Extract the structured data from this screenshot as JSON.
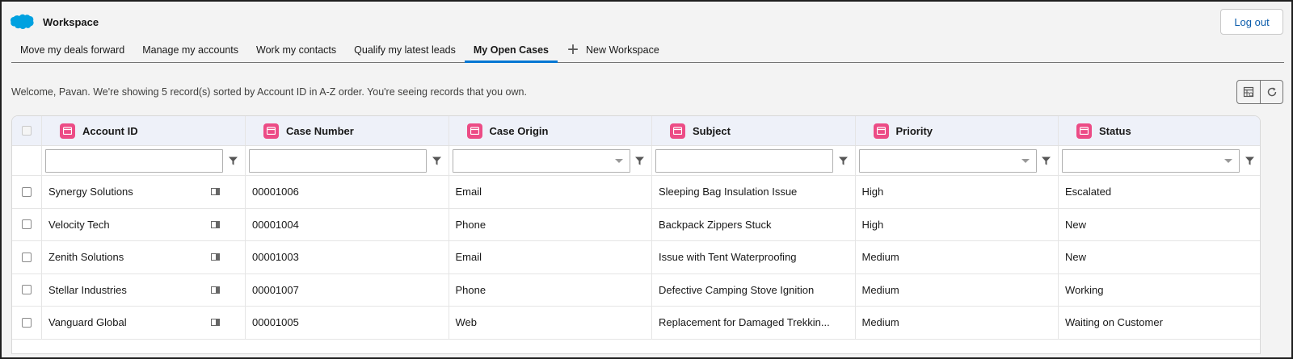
{
  "app": {
    "title": "Workspace",
    "logout_label": "Log out"
  },
  "tabs": [
    {
      "label": "Move my deals forward",
      "active": false
    },
    {
      "label": "Manage my accounts",
      "active": false
    },
    {
      "label": "Work my contacts",
      "active": false
    },
    {
      "label": "Qualify my latest leads",
      "active": false
    },
    {
      "label": "My Open Cases",
      "active": true
    }
  ],
  "new_tab_label": "New Workspace",
  "welcome_text": "Welcome, Pavan. We're showing 5 record(s) sorted by Account ID in A-Z order. You're seeing records that you own.",
  "columns": [
    {
      "label": "Account ID",
      "filter": "text"
    },
    {
      "label": "Case Number",
      "filter": "text"
    },
    {
      "label": "Case Origin",
      "filter": "select"
    },
    {
      "label": "Subject",
      "filter": "text"
    },
    {
      "label": "Priority",
      "filter": "select"
    },
    {
      "label": "Status",
      "filter": "select"
    }
  ],
  "rows": [
    {
      "account": "Synergy Solutions",
      "case_number": "00001006",
      "origin": "Email",
      "subject": "Sleeping Bag Insulation Issue",
      "priority": "High",
      "status": "Escalated"
    },
    {
      "account": "Velocity Tech",
      "case_number": "00001004",
      "origin": "Phone",
      "subject": "Backpack Zippers Stuck",
      "priority": "High",
      "status": "New"
    },
    {
      "account": "Zenith Solutions",
      "case_number": "00001003",
      "origin": "Email",
      "subject": "Issue with Tent Waterproofing",
      "priority": "Medium",
      "status": "New"
    },
    {
      "account": "Stellar Industries",
      "case_number": "00001007",
      "origin": "Phone",
      "subject": "Defective Camping Stove Ignition",
      "priority": "Medium",
      "status": "Working"
    },
    {
      "account": "Vanguard Global",
      "case_number": "00001005",
      "origin": "Web",
      "subject": "Replacement for Damaged Trekkin...",
      "priority": "Medium",
      "status": "Waiting on Customer"
    }
  ],
  "colors": {
    "brand": "#0176d3",
    "column_icon": "#ec4c86",
    "link": "#0b5cab"
  },
  "icons": {
    "logo": "salesforce-cloud-icon",
    "column": "calendar-icon",
    "filter": "filter-icon",
    "row_preview": "card-icon",
    "tools": [
      "table-settings-icon",
      "refresh-icon"
    ]
  }
}
